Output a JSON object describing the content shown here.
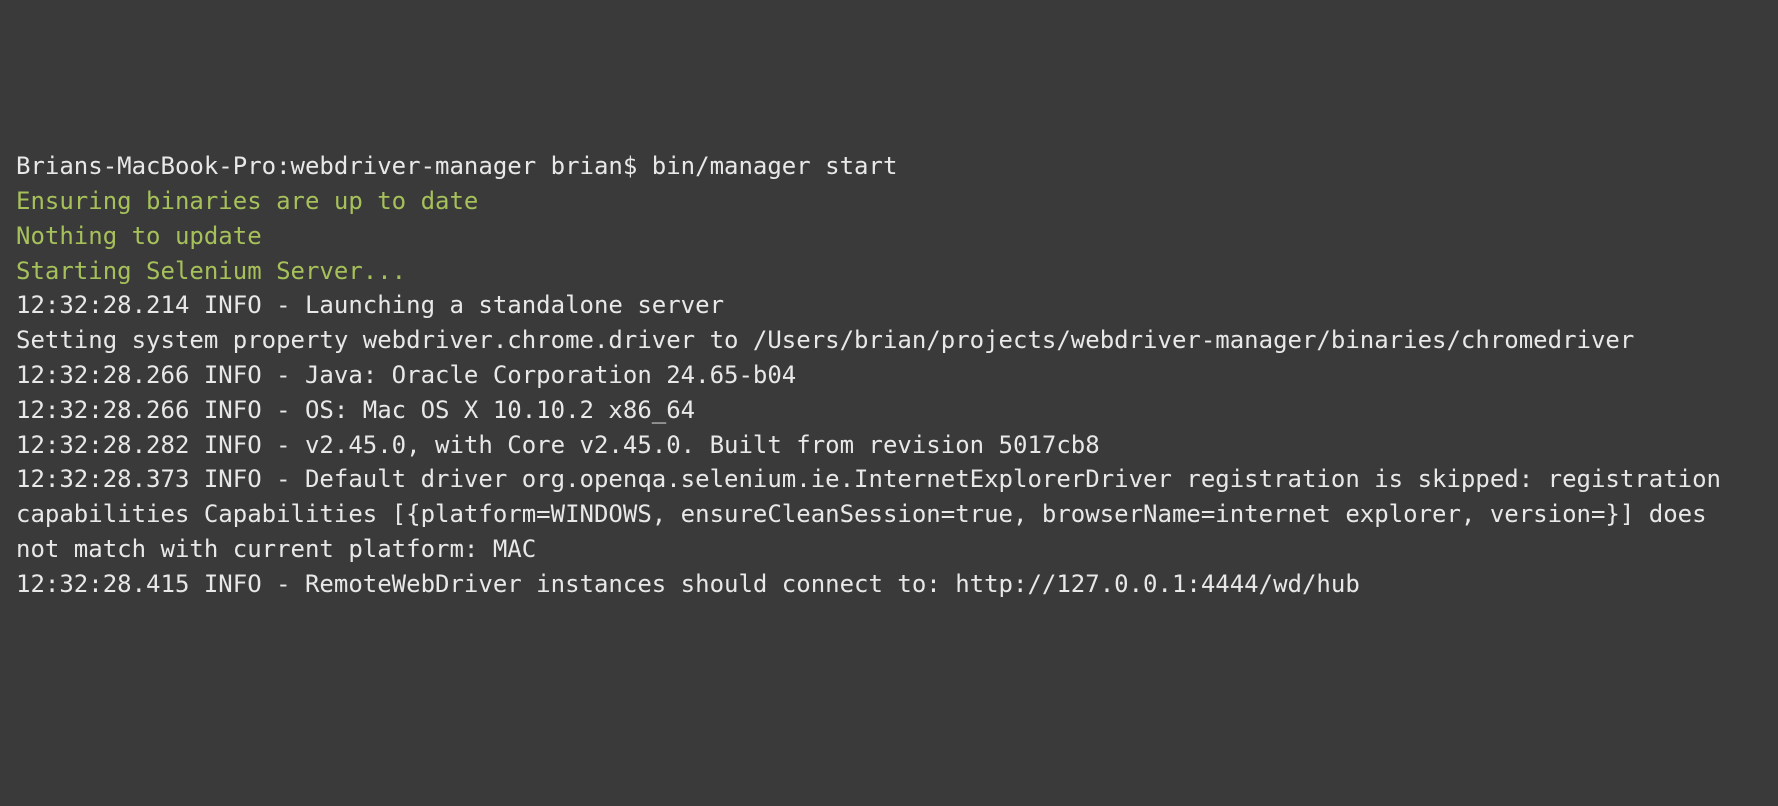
{
  "terminal": {
    "prompt_line": "Brians-MacBook-Pro:webdriver-manager brian$ bin/manager start",
    "status_lines": [
      "Ensuring binaries are up to date",
      "Nothing to update",
      "Starting Selenium Server..."
    ],
    "log_lines": [
      "12:32:28.214 INFO - Launching a standalone server",
      "Setting system property webdriver.chrome.driver to /Users/brian/projects/webdriver-manager/binaries/chromedriver",
      "12:32:28.266 INFO - Java: Oracle Corporation 24.65-b04",
      "12:32:28.266 INFO - OS: Mac OS X 10.10.2 x86_64",
      "12:32:28.282 INFO - v2.45.0, with Core v2.45.0. Built from revision 5017cb8",
      "12:32:28.373 INFO - Default driver org.openqa.selenium.ie.InternetExplorerDriver registration is skipped: registration capabilities Capabilities [{platform=WINDOWS, ensureCleanSession=true, browserName=internet explorer, version=}] does not match with current platform: MAC",
      "12:32:28.415 INFO - RemoteWebDriver instances should connect to: http://127.0.0.1:4444/wd/hub"
    ]
  }
}
